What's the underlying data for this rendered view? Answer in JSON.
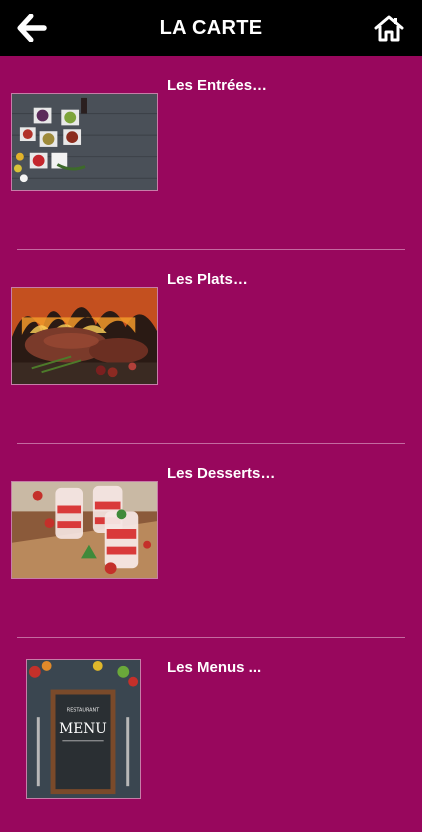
{
  "header": {
    "title": "LA CARTE",
    "back_icon": "arrow-left-icon",
    "home_icon": "home-icon"
  },
  "menu": {
    "items": [
      {
        "label": "Les Entrées…",
        "image": "starters-photo"
      },
      {
        "label": "Les Plats…",
        "image": "grilled-meat-photo"
      },
      {
        "label": "Les Desserts…",
        "image": "strawberry-dessert-photo"
      },
      {
        "label": "Les Menus ...",
        "image": "menu-board-photo"
      }
    ]
  },
  "colors": {
    "background": "#98075d",
    "header": "#000000",
    "text": "#ffffff",
    "divider": "#c46aa0"
  }
}
